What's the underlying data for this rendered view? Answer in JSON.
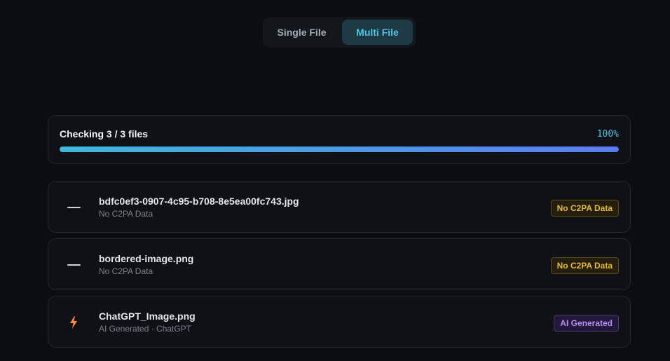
{
  "mode_toggle": {
    "options": [
      {
        "label": "Single File",
        "active": false
      },
      {
        "label": "Multi File",
        "active": true
      }
    ]
  },
  "progress": {
    "title": "Checking 3 / 3 files",
    "percent_label": "100%",
    "value": 1.0
  },
  "files": [
    {
      "name": "bdfc0ef3-0907-4c95-b708-8e5ea00fc743.jpg",
      "status": "No C2PA Data",
      "badge": "No C2PA Data",
      "icon": "dash-icon"
    },
    {
      "name": "bordered-image.png",
      "status": "No C2PA Data",
      "badge": "No C2PA Data",
      "icon": "dash-icon"
    },
    {
      "name": "ChatGPT_Image.png",
      "status": "AI Generated · ChatGPT",
      "badge": "AI Generated",
      "icon": "lightning-icon"
    }
  ],
  "colors": {
    "background": "#0b0d12",
    "accent": "#4fc3e6",
    "warning": "#e5b93a",
    "ai": "#b48cf0",
    "lightning": "#f08a4b"
  }
}
